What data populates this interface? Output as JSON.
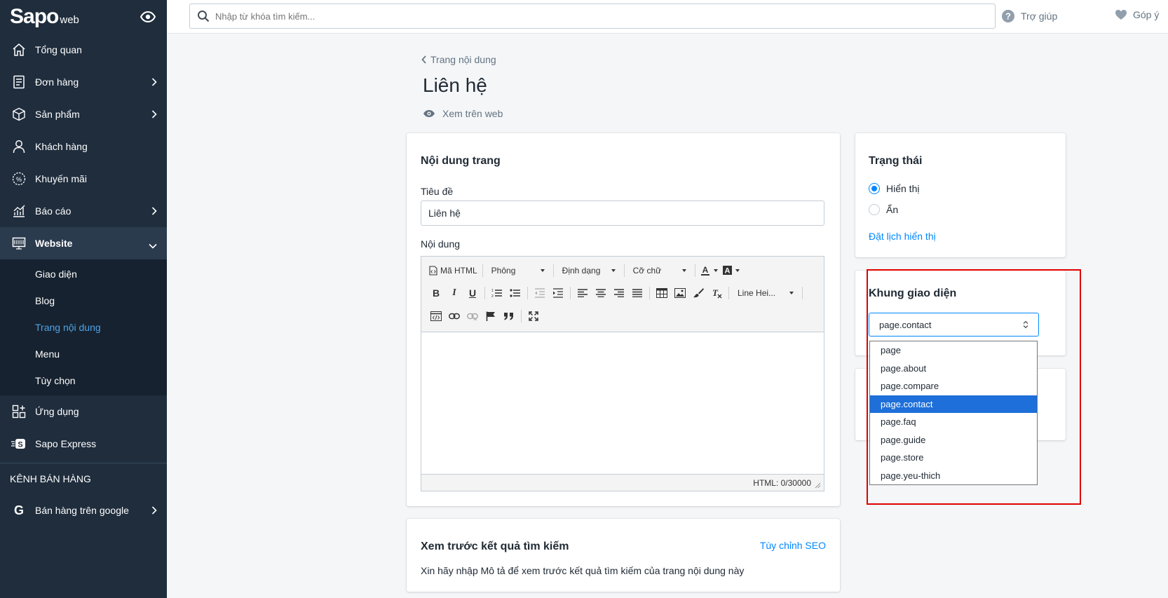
{
  "app": {
    "brand": "Sapo",
    "brand_sub": "web"
  },
  "search": {
    "placeholder": "Nhập từ khóa tìm kiếm..."
  },
  "topbar": {
    "help": "Trợ giúp",
    "feedback": "Góp ý"
  },
  "sidebar": {
    "items": [
      {
        "label": "Tổng quan",
        "icon": "home-icon"
      },
      {
        "label": "Đơn hàng",
        "icon": "orders-icon"
      },
      {
        "label": "Sản phẩm",
        "icon": "box-icon"
      },
      {
        "label": "Khách hàng",
        "icon": "user-icon"
      },
      {
        "label": "Khuyến mãi",
        "icon": "percent-icon"
      },
      {
        "label": "Báo cáo",
        "icon": "chart-icon"
      },
      {
        "label": "Website",
        "icon": "monitor-icon"
      }
    ],
    "website_sub": [
      "Giao diện",
      "Blog",
      "Trang nội dung",
      "Menu",
      "Tùy chọn"
    ],
    "apps": "Ứng dụng",
    "express": "Sapo Express",
    "channels_heading": "KÊNH BÁN HÀNG",
    "google": "Bán hàng trên google"
  },
  "page": {
    "breadcrumb": "Trang nội dung",
    "title": "Liên hệ",
    "view_web": "Xem trên web"
  },
  "content_card": {
    "title": "Nội dung trang",
    "title_label": "Tiêu đề",
    "title_value": "Liên hệ",
    "content_label": "Nội dung"
  },
  "editor": {
    "html_btn": "Mã HTML",
    "font": "Phông",
    "format": "Định dạng",
    "size": "Cỡ chữ",
    "line_height": "Line Hei...",
    "counter": "HTML: 0/30000"
  },
  "status_card": {
    "title": "Trạng thái",
    "show": "Hiển thị",
    "hide": "Ẩn",
    "schedule": "Đặt lịch hiển thị"
  },
  "template_card": {
    "title": "Khung giao diện",
    "selected": "page.contact",
    "options": [
      "page",
      "page.about",
      "page.compare",
      "page.contact",
      "page.faq",
      "page.guide",
      "page.store",
      "page.yeu-thich"
    ]
  },
  "seo_card": {
    "title": "Xem trước kết quả tìm kiếm",
    "customize": "Tùy chỉnh SEO",
    "hint": "Xin hãy nhập Mô tả để xem trước kết quả tìm kiếm của trang nội dung này"
  },
  "colors": {
    "sidebar": "#1f2d3d",
    "accent": "#0088ff",
    "highlight": "#e00000",
    "selected": "#1e6fd9"
  }
}
